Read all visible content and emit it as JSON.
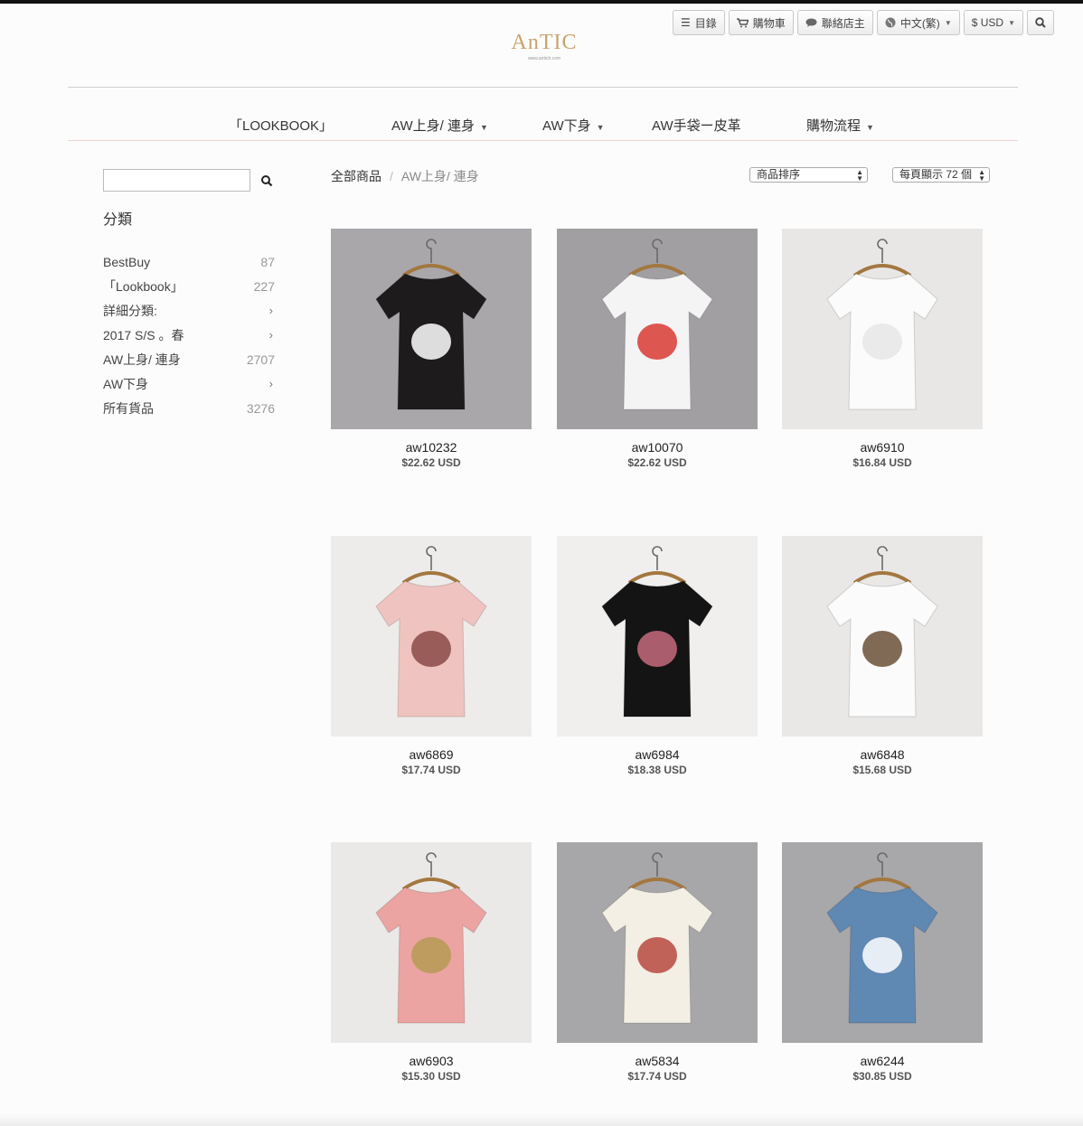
{
  "toolbar": {
    "menu": "目錄",
    "cart": "購物車",
    "contact": "聯絡店主",
    "language": "中文(繁)",
    "currency": "$ USD"
  },
  "logo": {
    "text": "AnTIC",
    "sub": "www.antich.com"
  },
  "nav": [
    {
      "label": "「LOOKBOOK」",
      "dropdown": false
    },
    {
      "label": "AW上身/ 連身",
      "dropdown": true
    },
    {
      "label": "AW下身",
      "dropdown": true
    },
    {
      "label": "AW手袋ー皮革",
      "dropdown": false
    },
    {
      "label": "購物流程",
      "dropdown": true
    }
  ],
  "sidebar": {
    "search_value": "",
    "heading": "分類",
    "categories": [
      {
        "label": "BestBuy",
        "count": "87"
      },
      {
        "label": "「Lookbook」",
        "count": "227"
      },
      {
        "label": "詳細分類:",
        "count": "›"
      },
      {
        "label": "2017 S/S 。春",
        "count": "›"
      },
      {
        "label": "AW上身/ 連身",
        "count": "2707"
      },
      {
        "label": "AW下身",
        "count": "›"
      },
      {
        "label": "所有貨品",
        "count": "3276"
      }
    ]
  },
  "breadcrumb": {
    "root": "全部商品",
    "separator": "/",
    "current": "AW上身/ 連身"
  },
  "sort": {
    "label": "商品排序"
  },
  "per_page": {
    "label": "每頁顯示 72 個"
  },
  "products": [
    {
      "name": "aw10232",
      "price": "$22.62 USD",
      "bg": "#a9a7aa",
      "garment": "#1e1b1c",
      "top": "#ffffff",
      "icon": "floral-dress-image"
    },
    {
      "name": "aw10070",
      "price": "$22.62 USD",
      "bg": "#a19fa2",
      "garment": "#f4f4f4",
      "top": "#d83a32",
      "icon": "print-shirt-image"
    },
    {
      "name": "aw6910",
      "price": "$16.84 USD",
      "bg": "#e8e7e6",
      "garment": "#fbfbfb",
      "top": "#e6e6e6",
      "icon": "white-tee-image"
    },
    {
      "name": "aw6869",
      "price": "$17.74 USD",
      "bg": "#edecea",
      "garment": "#efc3bf",
      "top": "#8a4a45",
      "icon": "pink-tee-image"
    },
    {
      "name": "aw6984",
      "price": "$18.38 USD",
      "bg": "#f0efee",
      "garment": "#141414",
      "top": "#c46a7d",
      "icon": "black-tee-image"
    },
    {
      "name": "aw6848",
      "price": "$15.68 USD",
      "bg": "#e9e8e6",
      "garment": "#fbfbfb",
      "top": "#6a5038",
      "icon": "bear-tee-image"
    },
    {
      "name": "aw6903",
      "price": "$15.30 USD",
      "bg": "#eae9e7",
      "garment": "#eba4a2",
      "top": "#b69a53",
      "icon": "smiley-tee-image"
    },
    {
      "name": "aw5834",
      "price": "$17.74 USD",
      "bg": "#a7a6a9",
      "garment": "#f3efe4",
      "top": "#b7493f",
      "icon": "floral-blouse-image"
    },
    {
      "name": "aw6244",
      "price": "$30.85 USD",
      "bg": "#a8a7aa",
      "garment": "#5f88b2",
      "top": "#ffffff",
      "icon": "denim-dress-image"
    }
  ]
}
